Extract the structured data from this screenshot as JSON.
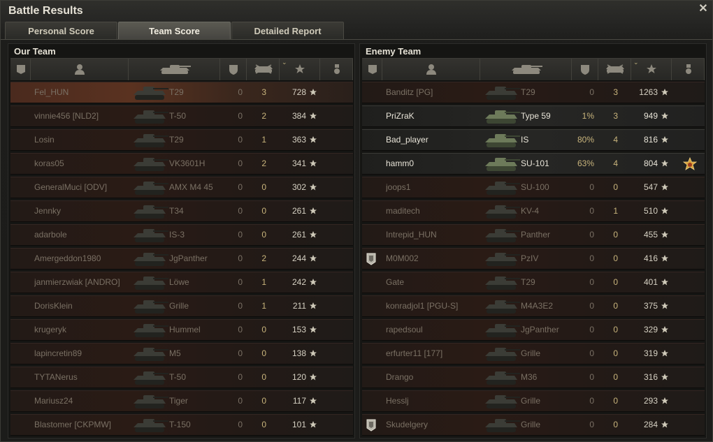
{
  "window": {
    "title": "Battle Results"
  },
  "tabs": [
    "Personal Score",
    "Team Score",
    "Detailed Report"
  ],
  "active_tab": 1,
  "colors": {
    "accent": "#c8b47c",
    "dead_row": "#2a1b15",
    "highlight_row": "#5a3220"
  },
  "our_team": {
    "title": "Our Team",
    "rows": [
      {
        "name": "Fel_HUN",
        "vehicle": "T29",
        "damage": "0",
        "kills": "3",
        "xp": "728",
        "alive": false,
        "hl": true
      },
      {
        "name": "vinnie456 [NLD2]",
        "vehicle": "T-50",
        "damage": "0",
        "kills": "2",
        "xp": "384",
        "alive": false
      },
      {
        "name": "Losin",
        "vehicle": "T29",
        "damage": "0",
        "kills": "1",
        "xp": "363",
        "alive": false
      },
      {
        "name": "koras05",
        "vehicle": "VK3601H",
        "damage": "0",
        "kills": "2",
        "xp": "341",
        "alive": false
      },
      {
        "name": "GeneralMuci [ODV]",
        "vehicle": "AMX M4 45",
        "damage": "0",
        "kills": "0",
        "xp": "302",
        "alive": false
      },
      {
        "name": "Jennky",
        "vehicle": "T34",
        "damage": "0",
        "kills": "0",
        "xp": "261",
        "alive": false
      },
      {
        "name": "adarbole",
        "vehicle": "IS-3",
        "damage": "0",
        "kills": "0",
        "xp": "261",
        "alive": false
      },
      {
        "name": "Amergeddon1980",
        "vehicle": "JgPanther",
        "damage": "0",
        "kills": "2",
        "xp": "244",
        "alive": false
      },
      {
        "name": "janmierzwiak [ANDRO]",
        "vehicle": "Löwe",
        "damage": "0",
        "kills": "1",
        "xp": "242",
        "alive": false
      },
      {
        "name": "DorisKlein",
        "vehicle": "Grille",
        "damage": "0",
        "kills": "1",
        "xp": "211",
        "alive": false
      },
      {
        "name": "krugeryk",
        "vehicle": "Hummel",
        "damage": "0",
        "kills": "0",
        "xp": "153",
        "alive": false
      },
      {
        "name": "lapincretin89",
        "vehicle": "M5",
        "damage": "0",
        "kills": "0",
        "xp": "138",
        "alive": false
      },
      {
        "name": "TYTANerus",
        "vehicle": "T-50",
        "damage": "0",
        "kills": "0",
        "xp": "120",
        "alive": false
      },
      {
        "name": "Mariusz24",
        "vehicle": "Tiger",
        "damage": "0",
        "kills": "0",
        "xp": "117",
        "alive": false
      },
      {
        "name": "Blastomer [CKPMW]",
        "vehicle": "T-150",
        "damage": "0",
        "kills": "0",
        "xp": "101",
        "alive": false
      }
    ]
  },
  "enemy_team": {
    "title": "Enemy Team",
    "rows": [
      {
        "name": "Banditz [PG]",
        "vehicle": "T29",
        "damage": "0",
        "kills": "3",
        "xp": "1263",
        "alive": false
      },
      {
        "name": "PriZraK",
        "vehicle": "Type 59",
        "damage": "1%",
        "kills": "3",
        "xp": "949",
        "alive": true
      },
      {
        "name": "Bad_player",
        "vehicle": "IS",
        "damage": "80%",
        "kills": "4",
        "xp": "816",
        "alive": true
      },
      {
        "name": "hamm0",
        "vehicle": "SU-101",
        "damage": "63%",
        "kills": "4",
        "xp": "804",
        "alive": true,
        "medal": true
      },
      {
        "name": "joops1",
        "vehicle": "SU-100",
        "damage": "0",
        "kills": "0",
        "xp": "547",
        "alive": false
      },
      {
        "name": "maditech",
        "vehicle": "KV-4",
        "damage": "0",
        "kills": "1",
        "xp": "510",
        "alive": false
      },
      {
        "name": "Intrepid_HUN",
        "vehicle": "Panther",
        "damage": "0",
        "kills": "0",
        "xp": "455",
        "alive": false
      },
      {
        "name": "M0M002",
        "vehicle": "PzIV",
        "damage": "0",
        "kills": "0",
        "xp": "416",
        "alive": false,
        "flag": true
      },
      {
        "name": "Gate",
        "vehicle": "T29",
        "damage": "0",
        "kills": "0",
        "xp": "401",
        "alive": false
      },
      {
        "name": "konradjol1 [PGU-S]",
        "vehicle": "M4A3E2",
        "damage": "0",
        "kills": "0",
        "xp": "375",
        "alive": false
      },
      {
        "name": "rapedsoul",
        "vehicle": "JgPanther",
        "damage": "0",
        "kills": "0",
        "xp": "329",
        "alive": false
      },
      {
        "name": "erfurter11 [177]",
        "vehicle": "Grille",
        "damage": "0",
        "kills": "0",
        "xp": "319",
        "alive": false
      },
      {
        "name": "Drango",
        "vehicle": "M36",
        "damage": "0",
        "kills": "0",
        "xp": "316",
        "alive": false
      },
      {
        "name": "Hesslj",
        "vehicle": "Grille",
        "damage": "0",
        "kills": "0",
        "xp": "293",
        "alive": false
      },
      {
        "name": "Skudelgery",
        "vehicle": "Grille",
        "damage": "0",
        "kills": "0",
        "xp": "284",
        "alive": false,
        "flag": true
      }
    ]
  }
}
